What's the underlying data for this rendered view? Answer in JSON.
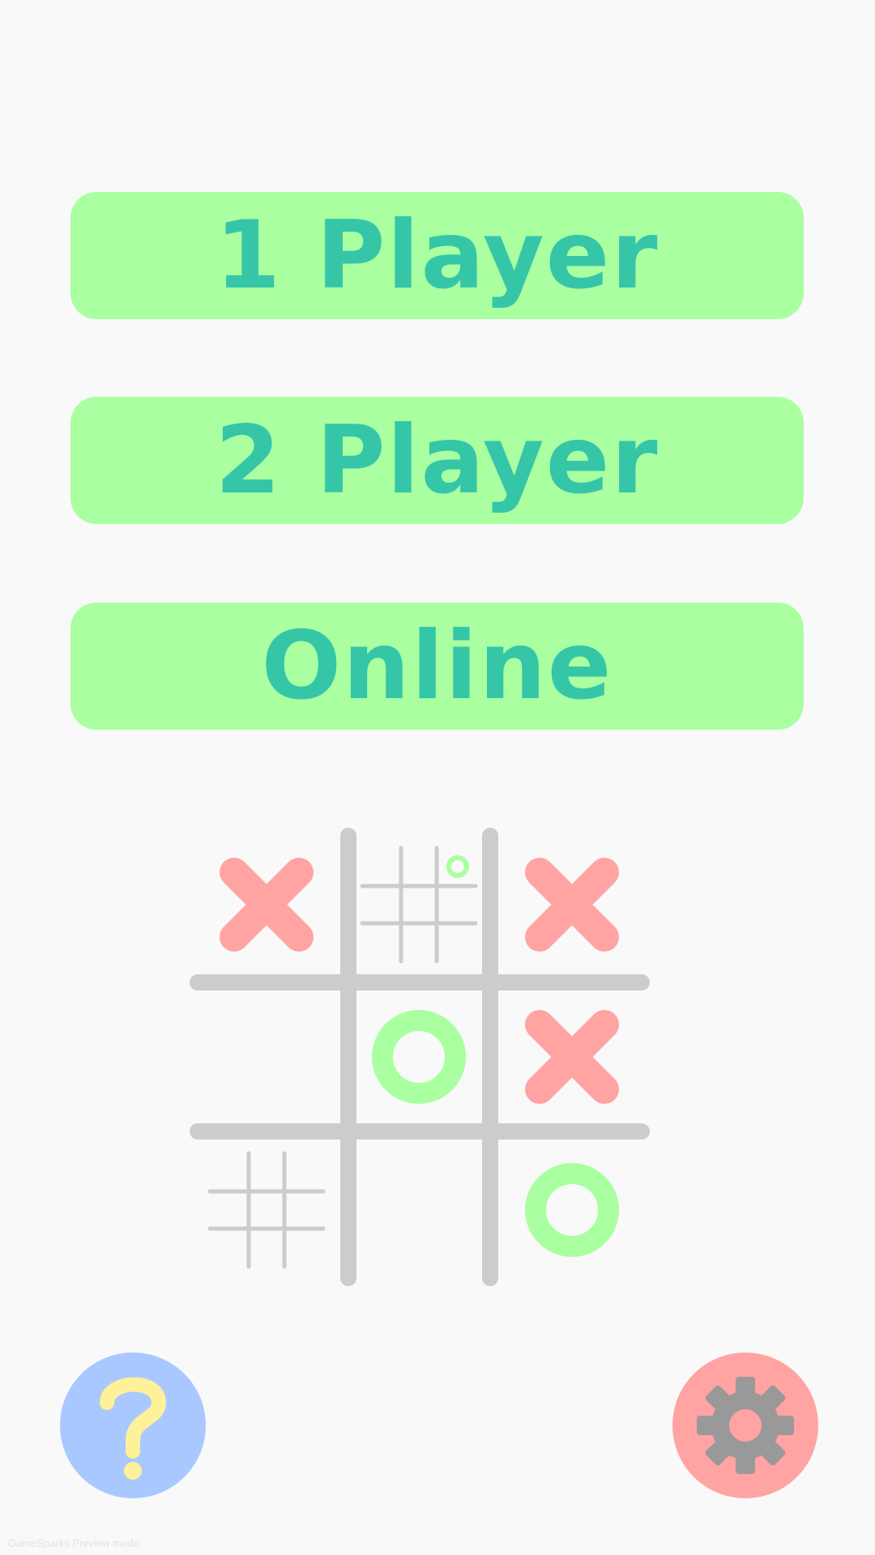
{
  "menu": {
    "one_player_label": "1 Player",
    "two_player_label": "2 Player",
    "online_label": "Online"
  },
  "board": {
    "cells": [
      "X",
      "grid-o",
      "X",
      "",
      "O",
      "X",
      "grid",
      "",
      "O"
    ]
  },
  "bottom": {
    "help_icon": "question-mark-icon",
    "settings_icon": "gear-icon"
  },
  "footer": {
    "preview_note": "GameSparks Preview mode"
  },
  "colors": {
    "background": "#f9f9f9",
    "button_fill": "#aaffa0",
    "button_text": "#35c6a8",
    "x_mark": "#ffa3a3",
    "o_mark": "#aaffa0",
    "grid": "#cccccc",
    "help_button": "#a9c8ff",
    "help_icon": "#fff09a",
    "settings_button": "#ffa3a3",
    "settings_icon": "#999999"
  }
}
